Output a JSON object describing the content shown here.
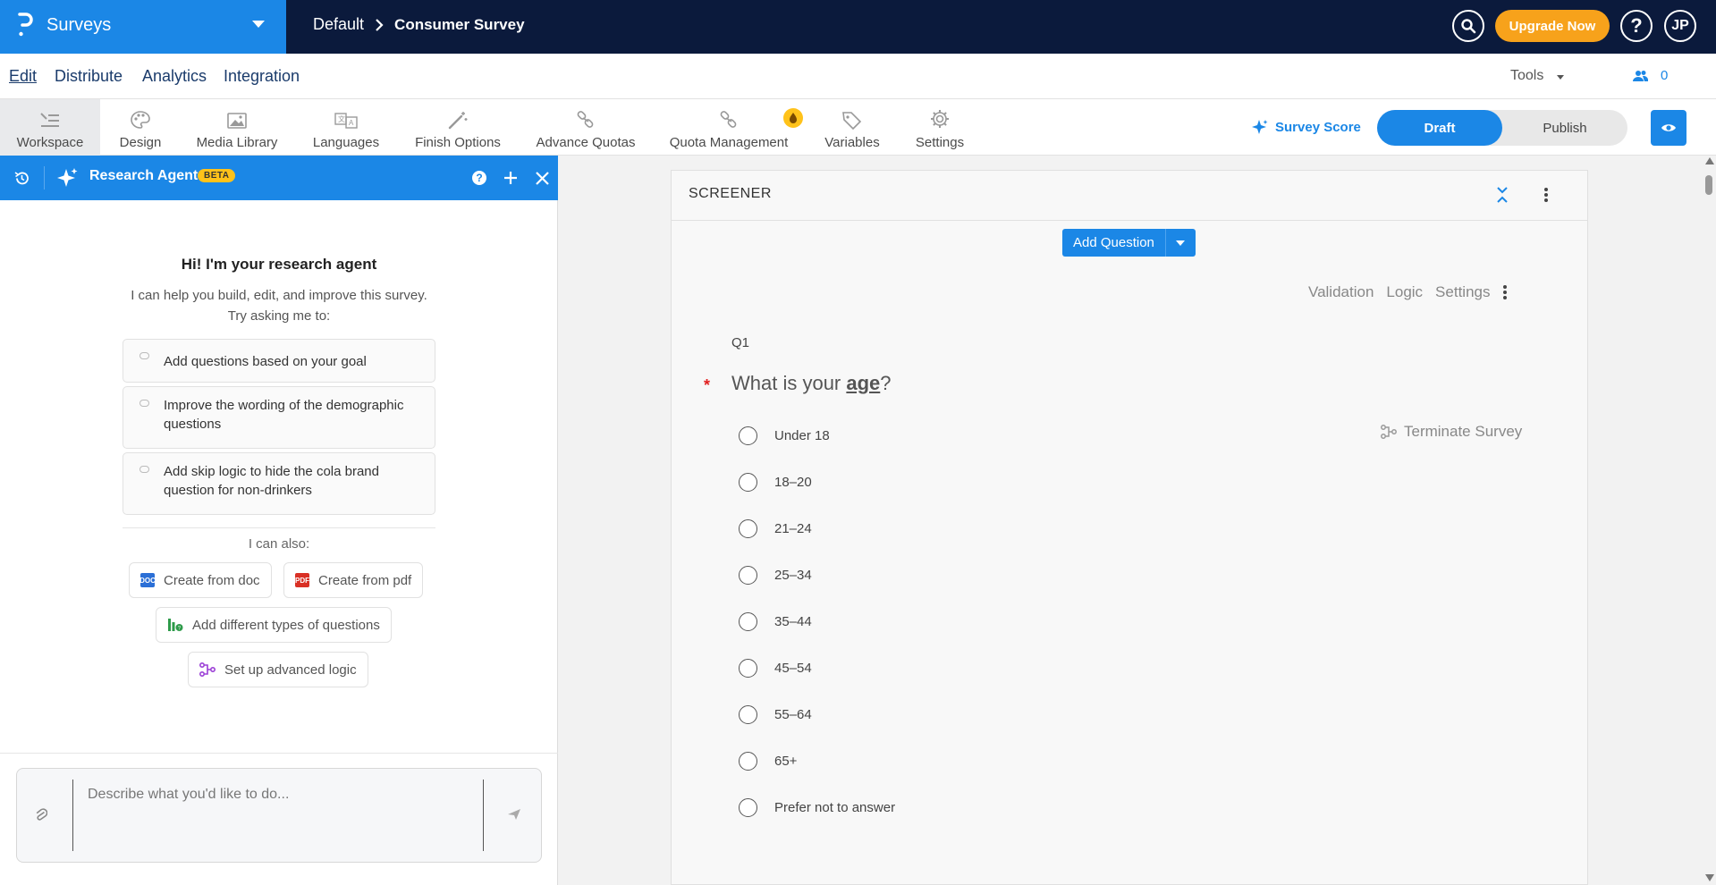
{
  "colors": {
    "brand": "#1b87e6",
    "nav_bg": "#0b1a3c",
    "upgrade": "#f7a21b",
    "beta": "#ffc21a",
    "required": "#e12020"
  },
  "app": {
    "name": "Surveys",
    "logo_icon": "brand-logo-icon"
  },
  "breadcrumb": {
    "folder": "Default",
    "survey": "Consumer Survey"
  },
  "header": {
    "search_icon": "search-icon",
    "upgrade_label": "Upgrade Now",
    "help_label": "?",
    "avatar_initials": "JP"
  },
  "menu": {
    "items": [
      {
        "label": "Edit",
        "active": true
      },
      {
        "label": "Distribute",
        "active": false
      },
      {
        "label": "Analytics",
        "active": false
      },
      {
        "label": "Integration",
        "active": false
      }
    ],
    "tools_label": "Tools",
    "collaborators_count": "0"
  },
  "toolbar": {
    "tabs": [
      {
        "label": "Workspace",
        "icon": "workspace-icon",
        "active": true
      },
      {
        "label": "Design",
        "icon": "palette-icon"
      },
      {
        "label": "Media Library",
        "icon": "image-icon"
      },
      {
        "label": "Languages",
        "icon": "translate-icon"
      },
      {
        "label": "Finish Options",
        "icon": "magic-wand-icon"
      },
      {
        "label": "Advance Quotas",
        "icon": "link-icon"
      },
      {
        "label": "Quota Management",
        "icon": "link-icon"
      },
      {
        "label": "Variables",
        "icon": "tag-icon"
      },
      {
        "label": "Settings",
        "icon": "gear-icon"
      }
    ],
    "survey_score_label": "Survey Score",
    "draft_label": "Draft",
    "publish_label": "Publish",
    "preview_icon": "eye-icon"
  },
  "agent": {
    "title": "Research Agent",
    "beta_label": "BETA",
    "intro_title": "Hi! I'm your research agent",
    "intro_line1": "I can help you build, edit, and improve this survey.",
    "intro_line2": "Try asking me to:",
    "suggestions": [
      "Add questions based on your goal",
      "Improve the wording of the demographic questions",
      "Add skip logic to hide the cola brand question for non-drinkers"
    ],
    "also_label": "I can also:",
    "chips": [
      "Create from doc",
      "Create from pdf",
      "Add different types of questions",
      "Set up advanced logic"
    ],
    "composer_placeholder": "Describe what you'd like to do..."
  },
  "survey": {
    "block_name": "SCREENER",
    "add_question_label": "Add Question",
    "question_actions": [
      "Validation",
      "Logic",
      "Settings"
    ],
    "question": {
      "number": "Q1",
      "required_mark": "*",
      "text_before": "What is your ",
      "text_emphasis": "age",
      "text_after": "?",
      "options": [
        "Under 18",
        "18–20",
        "21–24",
        "25–34",
        "35–44",
        "45–54",
        "55–64",
        "65+",
        "Prefer not to answer"
      ],
      "terminate_label": "Terminate Survey"
    }
  }
}
